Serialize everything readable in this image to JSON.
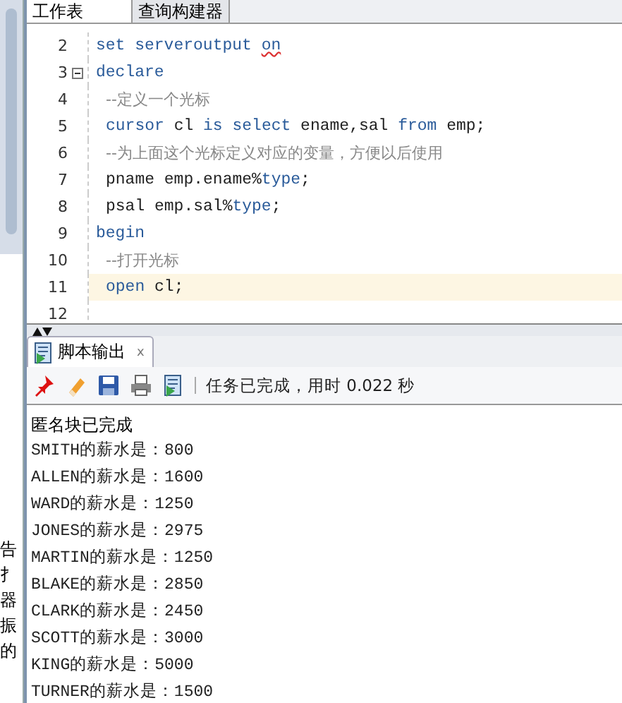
{
  "editor_tabs": [
    {
      "label": "工作表",
      "selected": true
    },
    {
      "label": "查询构建器",
      "selected": false
    }
  ],
  "code_lines": [
    {
      "number": "2",
      "foldable": false,
      "current": false,
      "indent": false,
      "tokens": [
        {
          "text": "set serveroutput ",
          "kind": "keyword"
        },
        {
          "text": "on",
          "kind": "warning"
        }
      ]
    },
    {
      "number": "3",
      "foldable": true,
      "current": false,
      "indent": false,
      "tokens": [
        {
          "text": "declare",
          "kind": "keyword"
        }
      ]
    },
    {
      "number": "4",
      "foldable": false,
      "current": false,
      "indent": true,
      "tokens": [
        {
          "text": "--定义一个光标",
          "kind": "comment"
        }
      ]
    },
    {
      "number": "5",
      "foldable": false,
      "current": false,
      "indent": true,
      "tokens": [
        {
          "text": "cursor",
          "kind": "keyword"
        },
        {
          "text": " cl ",
          "kind": "plain"
        },
        {
          "text": "is select",
          "kind": "keyword"
        },
        {
          "text": " ename,sal ",
          "kind": "plain"
        },
        {
          "text": "from",
          "kind": "keyword"
        },
        {
          "text": " emp;",
          "kind": "plain"
        }
      ]
    },
    {
      "number": "6",
      "foldable": false,
      "current": false,
      "indent": true,
      "tokens": [
        {
          "text": "--为上面这个光标定义对应的变量，方便以后使用",
          "kind": "comment"
        }
      ]
    },
    {
      "number": "7",
      "foldable": false,
      "current": false,
      "indent": true,
      "tokens": [
        {
          "text": "pname emp.ename%",
          "kind": "plain"
        },
        {
          "text": "type",
          "kind": "keyword"
        },
        {
          "text": ";",
          "kind": "plain"
        }
      ]
    },
    {
      "number": "8",
      "foldable": false,
      "current": false,
      "indent": true,
      "tokens": [
        {
          "text": "psal emp.sal%",
          "kind": "plain"
        },
        {
          "text": "type",
          "kind": "keyword"
        },
        {
          "text": ";",
          "kind": "plain"
        }
      ]
    },
    {
      "number": "9",
      "foldable": false,
      "current": false,
      "indent": false,
      "tokens": [
        {
          "text": "begin",
          "kind": "keyword"
        }
      ]
    },
    {
      "number": "10",
      "foldable": false,
      "current": false,
      "indent": true,
      "tokens": [
        {
          "text": "--打开光标",
          "kind": "comment"
        }
      ]
    },
    {
      "number": "11",
      "foldable": false,
      "current": true,
      "indent": true,
      "tokens": [
        {
          "text": "open",
          "kind": "keyword"
        },
        {
          "text": " cl;",
          "kind": "plain"
        }
      ]
    },
    {
      "number": "12",
      "foldable": false,
      "current": false
    }
  ],
  "side_fragments": [
    "告",
    "扌",
    "器",
    "振",
    "的"
  ],
  "output_tab": {
    "label": "脚本输出",
    "close": "x"
  },
  "toolbar": {
    "status": "任务已完成，用时 0.022 秒"
  },
  "output": {
    "header": "匿名块已完成",
    "lines": [
      {
        "name": "SMITH",
        "text": "的薪水是：",
        "value": "800"
      },
      {
        "name": "ALLEN",
        "text": "的薪水是：",
        "value": "1600"
      },
      {
        "name": "WARD",
        "text": "的薪水是：",
        "value": "1250"
      },
      {
        "name": "JONES",
        "text": "的薪水是：",
        "value": "2975"
      },
      {
        "name": "MARTIN",
        "text": "的薪水是：",
        "value": "1250"
      },
      {
        "name": "BLAKE",
        "text": "的薪水是：",
        "value": "2850"
      },
      {
        "name": "CLARK",
        "text": "的薪水是：",
        "value": "2450"
      },
      {
        "name": "SCOTT",
        "text": "的薪水是：",
        "value": "3000"
      },
      {
        "name": "KING",
        "text": "的薪水是：",
        "value": "5000"
      },
      {
        "name": "TURNER",
        "text": "的薪水是：",
        "value": "1500"
      }
    ]
  }
}
